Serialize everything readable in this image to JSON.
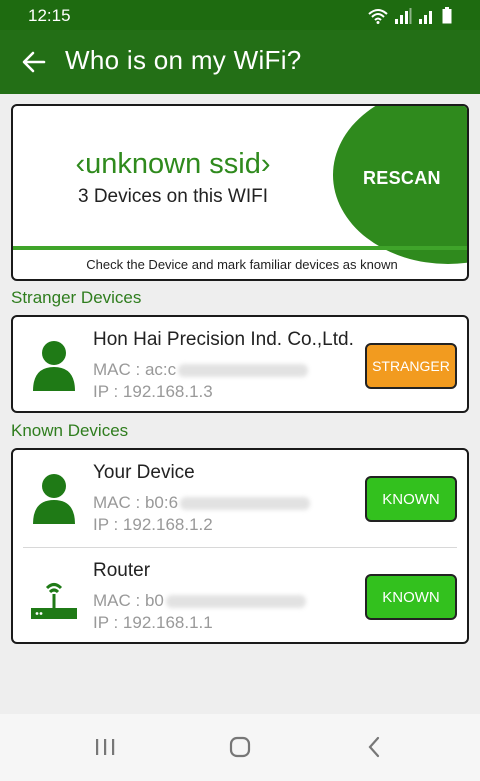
{
  "status": {
    "time": "12:15"
  },
  "app": {
    "title": "Who is on my WiFi?"
  },
  "ssid_card": {
    "ssid": "‹unknown ssid›",
    "device_count": "3 Devices on this WIFI",
    "rescan_label": "RESCAN",
    "hint": "Check the Device and mark familiar devices as known"
  },
  "stranger_section": {
    "title": "Stranger Devices",
    "devices": [
      {
        "name": "Hon Hai Precision Ind. Co.,Ltd.",
        "mac_prefix": "MAC : ac:c",
        "ip": "IP : 192.168.1.3",
        "button": "STRANGER",
        "icon": "person-icon"
      }
    ]
  },
  "known_section": {
    "title": "Known Devices",
    "devices": [
      {
        "name": "Your Device",
        "mac_prefix": "MAC : b0:6",
        "ip": "IP : 192.168.1.2",
        "button": "KNOWN",
        "icon": "person-icon"
      },
      {
        "name": "Router",
        "mac_prefix": "MAC : b0",
        "ip": "IP : 192.168.1.1",
        "button": "KNOWN",
        "icon": "router-icon"
      }
    ]
  },
  "colors": {
    "app_bar": "#236f16",
    "accent_green": "#2f8a1d",
    "known_button": "#33c11e",
    "stranger_button": "#f29b1f"
  }
}
